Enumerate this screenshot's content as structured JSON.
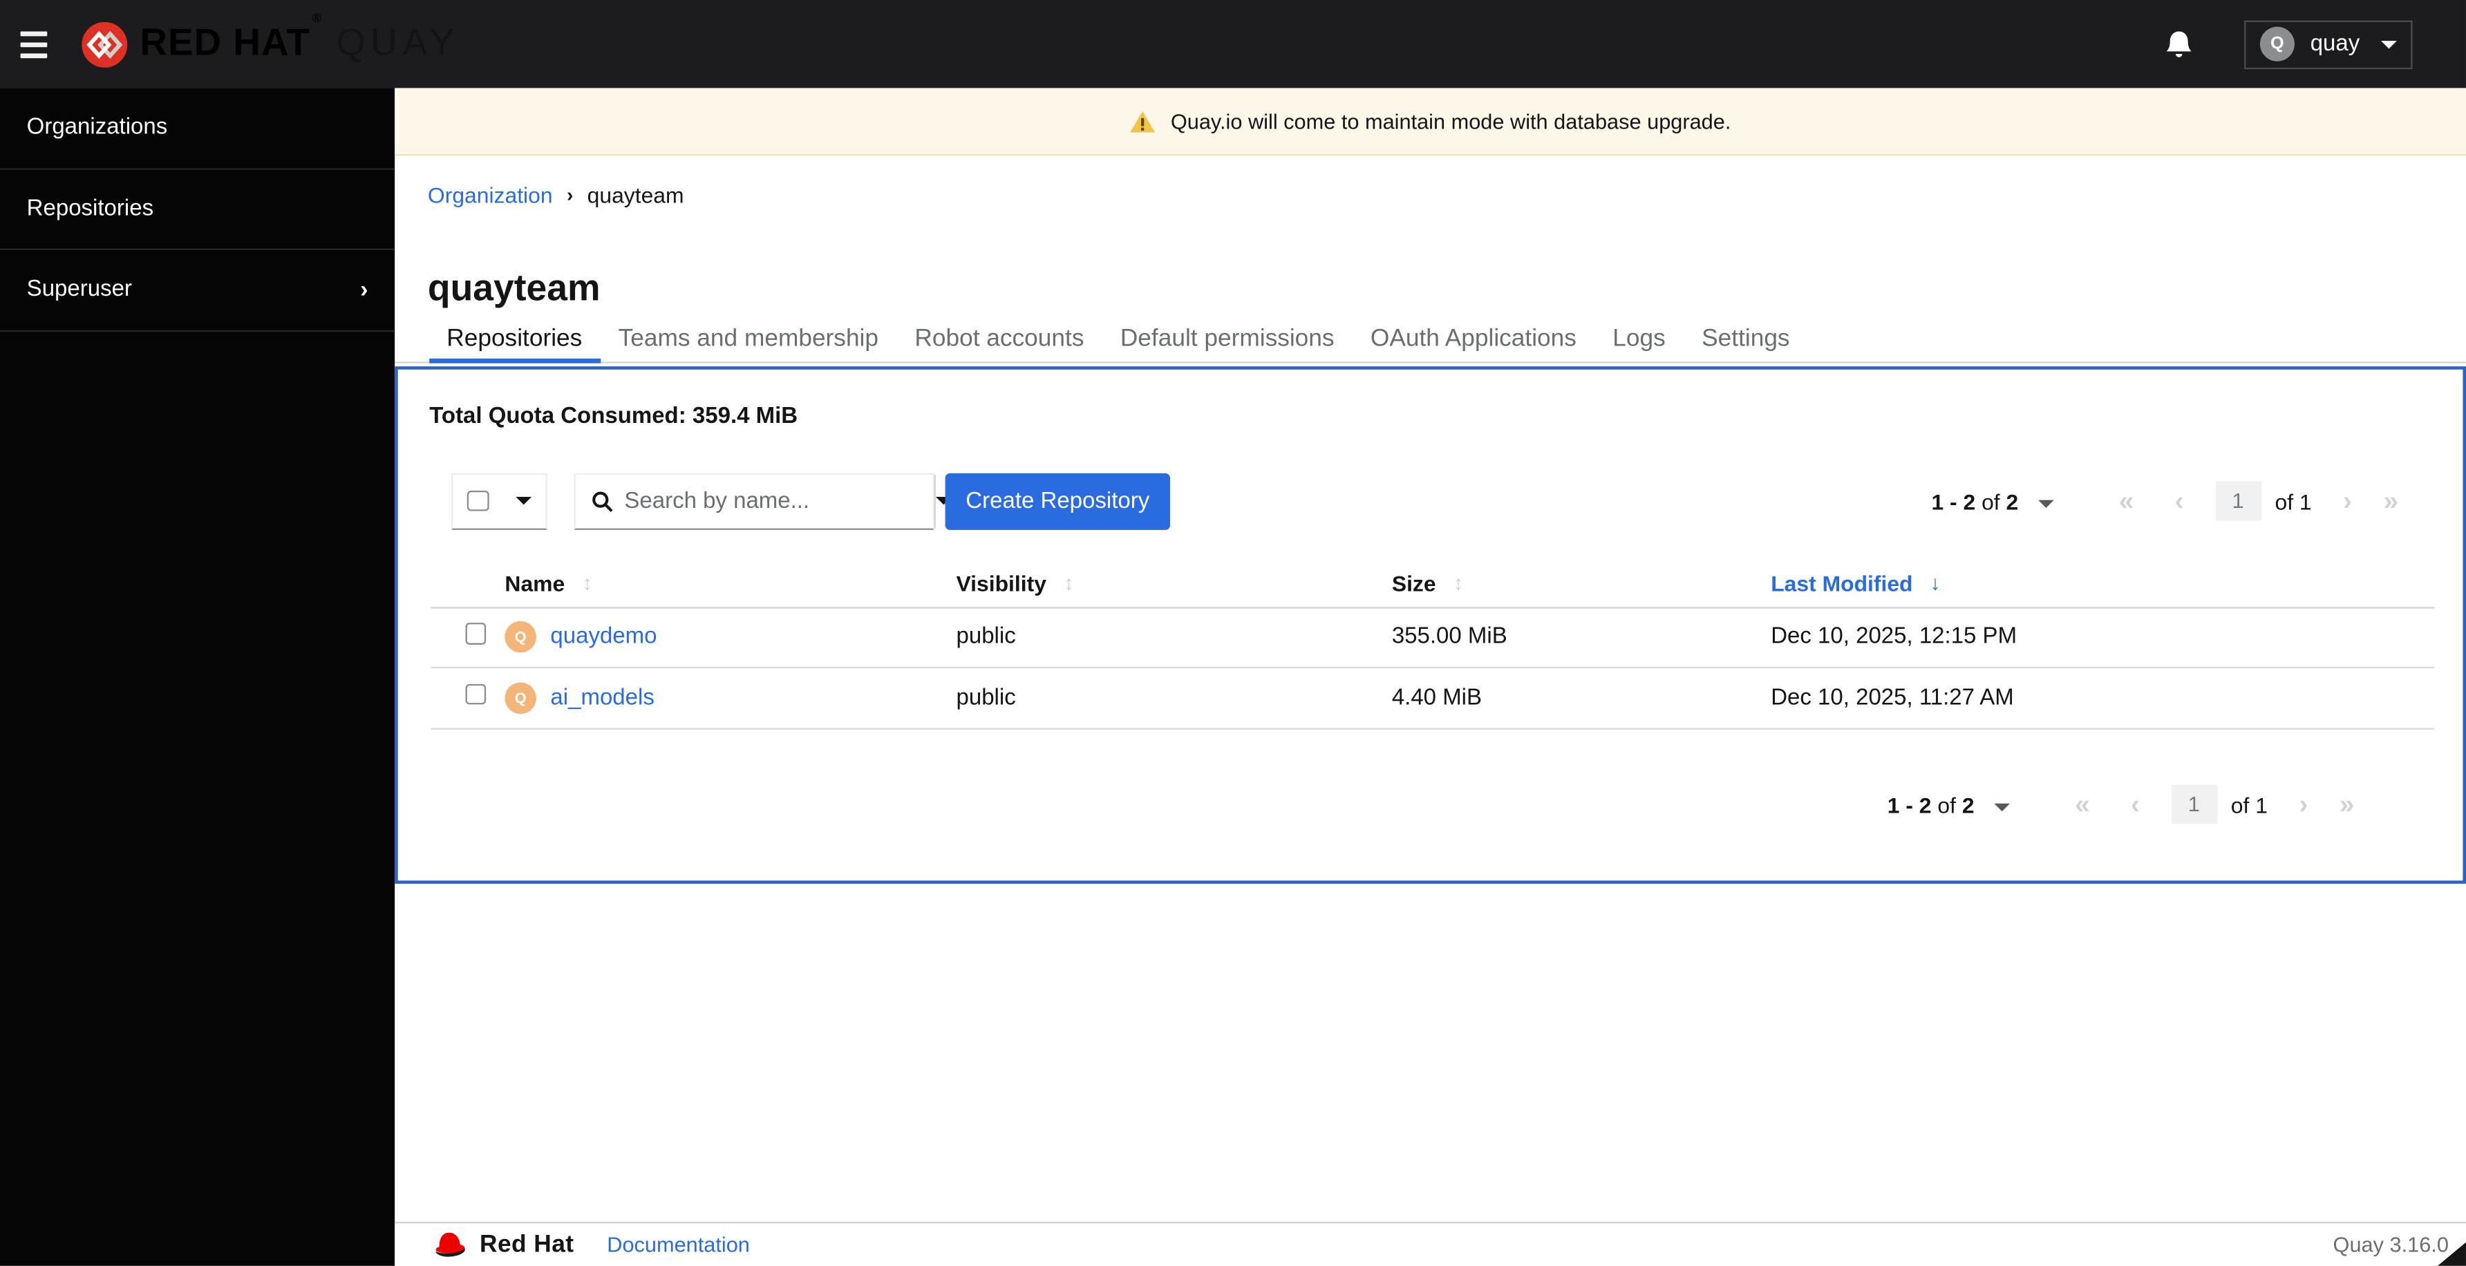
{
  "colors": {
    "accent_blue": "#2a6ce0",
    "panel_border": "#2b63c4",
    "primary_button_bg": "#2a6ce0",
    "warning_gold": "#f0c644",
    "banner_bg": "#fcf7e8",
    "avatar_orange": "#f4b678",
    "masthead_bg": "#1c1c1e",
    "sidebar_bg": "#050505",
    "quay_logo_red": "#dd3126",
    "redhat_red": "#ee0000"
  },
  "header": {
    "brand": {
      "red_hat": "RED HAT",
      "registered": "®",
      "product": "QUAY"
    },
    "user_menu": {
      "avatar_letter": "Q",
      "name": "quay"
    }
  },
  "sidebar": {
    "items": [
      "Organizations",
      "Repositories",
      "Superuser"
    ]
  },
  "banner": {
    "message": "Quay.io will come to maintain mode with database upgrade."
  },
  "breadcrumb": {
    "parent": "Organization",
    "current": "quayteam"
  },
  "page": {
    "title": "quayteam"
  },
  "tabs": [
    "Repositories",
    "Teams and membership",
    "Robot accounts",
    "Default permissions",
    "OAuth Applications",
    "Logs",
    "Settings"
  ],
  "active_tab": "Repositories",
  "quota": {
    "label": "Total Quota Consumed:",
    "value": "359.4 MiB"
  },
  "toolbar": {
    "search_placeholder": "Search by name...",
    "create_button": "Create Repository"
  },
  "pagination": {
    "range": "1 - 2",
    "of_word": "of",
    "total": "2",
    "page": "1",
    "page_of": "of 1"
  },
  "table": {
    "columns": [
      {
        "label": "Name",
        "sort": "sortable"
      },
      {
        "label": "Visibility",
        "sort": "sortable"
      },
      {
        "label": "Size",
        "sort": "sortable"
      },
      {
        "label": "Last Modified",
        "sort": "desc"
      }
    ],
    "rows": [
      {
        "avatar_letter": "Q",
        "name": "quaydemo",
        "visibility": "public",
        "size": "355.00 MiB",
        "last_modified": "Dec 10, 2025, 12:15 PM"
      },
      {
        "avatar_letter": "Q",
        "name": "ai_models",
        "visibility": "public",
        "size": "4.40 MiB",
        "last_modified": "Dec 10, 2025, 11:27 AM"
      }
    ]
  },
  "footer": {
    "brand": "Red Hat",
    "documentation_link": "Documentation",
    "version": "Quay 3.16.0"
  }
}
